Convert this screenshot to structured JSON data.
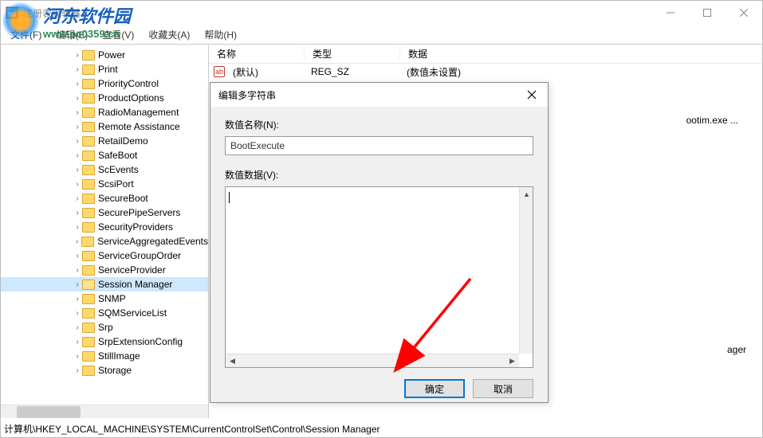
{
  "window": {
    "title": "注册表编辑器"
  },
  "menu": {
    "file": "文件(F)",
    "edit": "编辑(E)",
    "view": "查看(V)",
    "favorites": "收藏夹(A)",
    "help": "帮助(H)"
  },
  "tree": {
    "items": [
      {
        "label": "Power",
        "indent": 5
      },
      {
        "label": "Print",
        "indent": 5
      },
      {
        "label": "PriorityControl",
        "indent": 5
      },
      {
        "label": "ProductOptions",
        "indent": 5
      },
      {
        "label": "RadioManagement",
        "indent": 5
      },
      {
        "label": "Remote Assistance",
        "indent": 5
      },
      {
        "label": "RetailDemo",
        "indent": 5
      },
      {
        "label": "SafeBoot",
        "indent": 5
      },
      {
        "label": "ScEvents",
        "indent": 5
      },
      {
        "label": "ScsiPort",
        "indent": 5
      },
      {
        "label": "SecureBoot",
        "indent": 5
      },
      {
        "label": "SecurePipeServers",
        "indent": 5
      },
      {
        "label": "SecurityProviders",
        "indent": 5
      },
      {
        "label": "ServiceAggregatedEvents",
        "indent": 5
      },
      {
        "label": "ServiceGroupOrder",
        "indent": 5
      },
      {
        "label": "ServiceProvider",
        "indent": 5
      },
      {
        "label": "Session Manager",
        "indent": 5,
        "selected": true
      },
      {
        "label": "SNMP",
        "indent": 5
      },
      {
        "label": "SQMServiceList",
        "indent": 5
      },
      {
        "label": "Srp",
        "indent": 5
      },
      {
        "label": "SrpExtensionConfig",
        "indent": 5
      },
      {
        "label": "StillImage",
        "indent": 5
      },
      {
        "label": "Storage",
        "indent": 5
      }
    ]
  },
  "list": {
    "columns": {
      "name": "名称",
      "type": "类型",
      "data": "数据"
    },
    "rows": [
      {
        "icon": "ab",
        "name": "(默认)",
        "type": "REG_SZ",
        "data": "(数值未设置)"
      }
    ],
    "partial_data": "ootim.exe ...",
    "fragment": "ager"
  },
  "statusbar": {
    "path": "计算机\\HKEY_LOCAL_MACHINE\\SYSTEM\\CurrentControlSet\\Control\\Session Manager"
  },
  "dialog": {
    "title": "编辑多字符串",
    "name_label": "数值名称(N):",
    "name_value": "BootExecute",
    "data_label": "数值数据(V):",
    "data_value": "",
    "ok": "确定",
    "cancel": "取消"
  },
  "watermark": {
    "cn": "河东软件园",
    "url": "www.pc0359.cn"
  }
}
